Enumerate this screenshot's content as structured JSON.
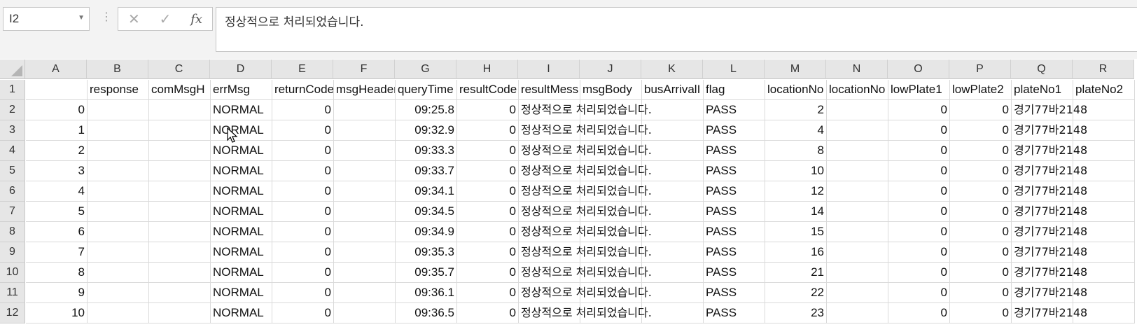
{
  "formula_bar": {
    "name_box": "I2",
    "cancel_glyph": "✕",
    "enter_glyph": "✓",
    "fx_glyph": "fx",
    "formula_value": "정상적으로 처리되었습니다."
  },
  "columns": [
    "A",
    "B",
    "C",
    "D",
    "E",
    "F",
    "G",
    "H",
    "I",
    "J",
    "K",
    "L",
    "M",
    "N",
    "O",
    "P",
    "Q",
    "R"
  ],
  "header_row": [
    "",
    "response",
    "comMsgH",
    "errMsg",
    "returnCode",
    "msgHeader",
    "queryTime",
    "resultCode",
    "resultMess",
    "msgBody",
    "busArrivalI",
    "flag",
    "locationNo",
    "locationNo",
    "lowPlate1",
    "lowPlate2",
    "plateNo1",
    "plateNo2"
  ],
  "rows": [
    {
      "row": "2",
      "index": "0",
      "errMsg": "NORMAL",
      "returnCode": "0",
      "queryTime": "09:25.8",
      "resultCode": "0",
      "resultMsg": "정상적으로 처리되었습니다.",
      "flag": "PASS",
      "locationNo": "2",
      "lowPlate1": "0",
      "lowPlate2": "0",
      "plateNo1": "경기77바2148"
    },
    {
      "row": "3",
      "index": "1",
      "errMsg": "NORMAL",
      "returnCode": "0",
      "queryTime": "09:32.9",
      "resultCode": "0",
      "resultMsg": "정상적으로 처리되었습니다.",
      "flag": "PASS",
      "locationNo": "4",
      "lowPlate1": "0",
      "lowPlate2": "0",
      "plateNo1": "경기77바2148"
    },
    {
      "row": "4",
      "index": "2",
      "errMsg": "NORMAL",
      "returnCode": "0",
      "queryTime": "09:33.3",
      "resultCode": "0",
      "resultMsg": "정상적으로 처리되었습니다.",
      "flag": "PASS",
      "locationNo": "8",
      "lowPlate1": "0",
      "lowPlate2": "0",
      "plateNo1": "경기77바2148"
    },
    {
      "row": "5",
      "index": "3",
      "errMsg": "NORMAL",
      "returnCode": "0",
      "queryTime": "09:33.7",
      "resultCode": "0",
      "resultMsg": "정상적으로 처리되었습니다.",
      "flag": "PASS",
      "locationNo": "10",
      "lowPlate1": "0",
      "lowPlate2": "0",
      "plateNo1": "경기77바2148"
    },
    {
      "row": "6",
      "index": "4",
      "errMsg": "NORMAL",
      "returnCode": "0",
      "queryTime": "09:34.1",
      "resultCode": "0",
      "resultMsg": "정상적으로 처리되었습니다.",
      "flag": "PASS",
      "locationNo": "12",
      "lowPlate1": "0",
      "lowPlate2": "0",
      "plateNo1": "경기77바2148"
    },
    {
      "row": "7",
      "index": "5",
      "errMsg": "NORMAL",
      "returnCode": "0",
      "queryTime": "09:34.5",
      "resultCode": "0",
      "resultMsg": "정상적으로 처리되었습니다.",
      "flag": "PASS",
      "locationNo": "14",
      "lowPlate1": "0",
      "lowPlate2": "0",
      "plateNo1": "경기77바2148"
    },
    {
      "row": "8",
      "index": "6",
      "errMsg": "NORMAL",
      "returnCode": "0",
      "queryTime": "09:34.9",
      "resultCode": "0",
      "resultMsg": "정상적으로 처리되었습니다.",
      "flag": "PASS",
      "locationNo": "15",
      "lowPlate1": "0",
      "lowPlate2": "0",
      "plateNo1": "경기77바2148"
    },
    {
      "row": "9",
      "index": "7",
      "errMsg": "NORMAL",
      "returnCode": "0",
      "queryTime": "09:35.3",
      "resultCode": "0",
      "resultMsg": "정상적으로 처리되었습니다.",
      "flag": "PASS",
      "locationNo": "16",
      "lowPlate1": "0",
      "lowPlate2": "0",
      "plateNo1": "경기77바2148"
    },
    {
      "row": "10",
      "index": "8",
      "errMsg": "NORMAL",
      "returnCode": "0",
      "queryTime": "09:35.7",
      "resultCode": "0",
      "resultMsg": "정상적으로 처리되었습니다.",
      "flag": "PASS",
      "locationNo": "21",
      "lowPlate1": "0",
      "lowPlate2": "0",
      "plateNo1": "경기77바2148"
    },
    {
      "row": "11",
      "index": "9",
      "errMsg": "NORMAL",
      "returnCode": "0",
      "queryTime": "09:36.1",
      "resultCode": "0",
      "resultMsg": "정상적으로 처리되었습니다.",
      "flag": "PASS",
      "locationNo": "22",
      "lowPlate1": "0",
      "lowPlate2": "0",
      "plateNo1": "경기77바2148"
    },
    {
      "row": "12",
      "index": "10",
      "errMsg": "NORMAL",
      "returnCode": "0",
      "queryTime": "09:36.5",
      "resultCode": "0",
      "resultMsg": "정상적으로 처리되었습니다.",
      "flag": "PASS",
      "locationNo": "23",
      "lowPlate1": "0",
      "lowPlate2": "0",
      "plateNo1": "경기77바2148"
    }
  ],
  "icons": {
    "cursor": "mouse-pointer-icon"
  }
}
